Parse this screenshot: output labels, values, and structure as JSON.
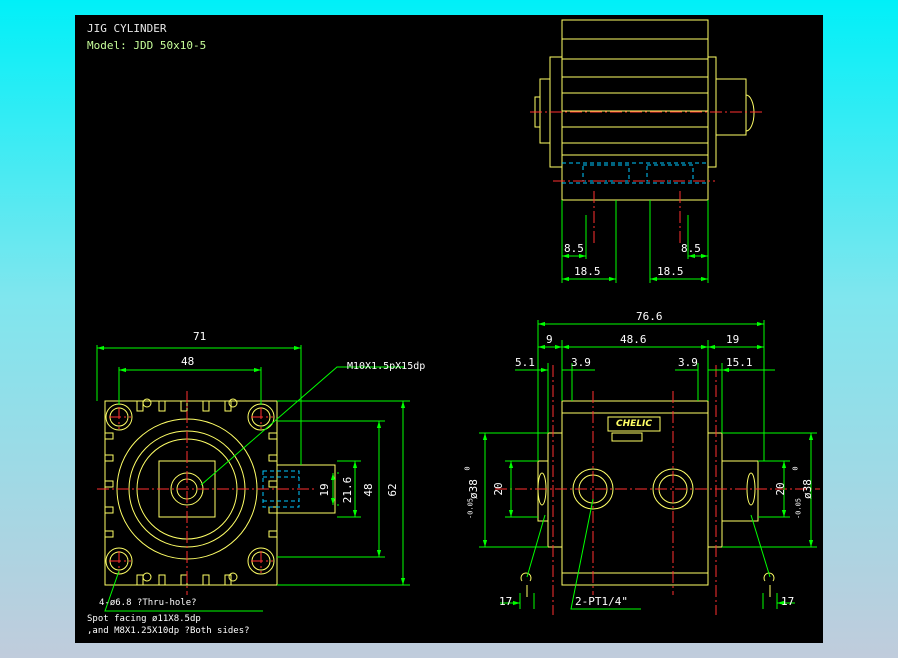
{
  "title": "JIG CYLINDER",
  "model": "Model:  JDD 50x10-5",
  "brand_label": "CHELIC",
  "colors": {
    "background": "#000000",
    "outline": "#ffff66",
    "dimension": "#00ff00",
    "centerline": "#ff3030",
    "hidden": "#00c8ff",
    "text": "#ffffff",
    "page_gradient_top": "#00f0f8",
    "page_gradient_bottom": "#c0ccdc"
  },
  "front_view": {
    "dims": {
      "w71": "71",
      "w48": "48",
      "h19": "19",
      "h21_6": "21.6",
      "h48": "48",
      "h62": "62"
    },
    "thread_callout": "M10X1.5pX15dp",
    "notes": [
      "4-ø6.8 ?Thru-hole?",
      "Spot facing  ø11X8.5dp",
      ",and M8X1.25X10dp ?Both sides?"
    ]
  },
  "top_view": {
    "dims": {
      "l8_5": "8.5",
      "r8_5": "8.5",
      "l18_5": "18.5",
      "r18_5": "18.5"
    }
  },
  "side_view": {
    "dims": {
      "total": "76.6",
      "a9": "9",
      "b48_6": "48.6",
      "c19": "19",
      "d5_1": "5.1",
      "e3_9": "3.9",
      "f3_9": "3.9",
      "g15_1": "15.1",
      "left20": "20",
      "right20": "20",
      "left_dia": "ø38",
      "right_dia": "ø38",
      "tol_upper": "0",
      "tol_lower": "-0.05",
      "left17": "17",
      "right17": "17"
    },
    "port_note": "2-PT1/4\""
  }
}
